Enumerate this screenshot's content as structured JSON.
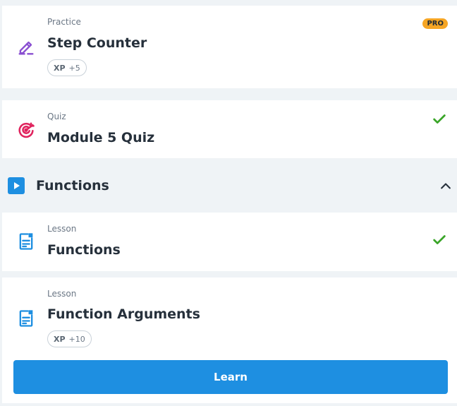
{
  "items": [
    {
      "type": "Practice",
      "title": "Step Counter",
      "xp_label": "XP",
      "xp_value": "+5",
      "badge": "PRO",
      "icon": "pencil-edit-icon"
    },
    {
      "type": "Quiz",
      "title": "Module 5 Quiz",
      "icon": "target-icon",
      "completed": true
    }
  ],
  "section": {
    "title": "Functions",
    "icon": "play-icon",
    "expanded": true
  },
  "section_items": [
    {
      "type": "Lesson",
      "title": "Functions",
      "icon": "document-icon",
      "completed": true
    },
    {
      "type": "Lesson",
      "title": "Function Arguments",
      "icon": "document-icon",
      "xp_label": "XP",
      "xp_value": "+10",
      "button_label": "Learn"
    }
  ],
  "colors": {
    "accent": "#1e8fe1",
    "pro": "#f5a524",
    "check": "#3aa528",
    "practice_icon": "#8a4fd1",
    "quiz_icon": "#e0245e"
  }
}
